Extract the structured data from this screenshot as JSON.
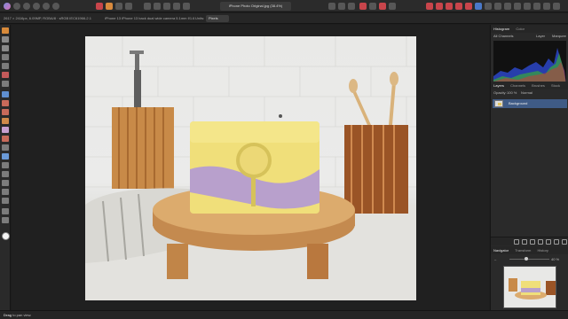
{
  "toolbar": {
    "doc_title": "iPhone Photo Original.jpg (38.4%)"
  },
  "context": {
    "dimensions": "2617 × 2416px, 6.09MP, RGBA/8 · sRGB IEC61966-2.1",
    "camera": "iPhone 13 iPhone 13 back dual wide camera 5.1mm f/1.6",
    "units_label": "Units:",
    "units_value": "Pixels"
  },
  "panels": {
    "histogram_tabs": [
      "Histogram",
      "Color"
    ],
    "channels_label": "All Channels",
    "layer_option": "Layer",
    "marquee_option": "Marquee",
    "layers_tabs": [
      "Layers",
      "Channels",
      "Brushes",
      "Stock"
    ],
    "opacity_label": "Opacity:",
    "opacity_value": "100 %",
    "blend_mode": "Normal",
    "layer_name": "Background",
    "nav_tabs": [
      "Navigator",
      "Transform",
      "History"
    ],
    "zoom_value": "40 %"
  },
  "status": {
    "hint_bold": "Drag",
    "hint_rest": " to pan view."
  },
  "colors": {
    "accent": "#3f5b86",
    "foreground_swatch": "#f5f5f5"
  }
}
